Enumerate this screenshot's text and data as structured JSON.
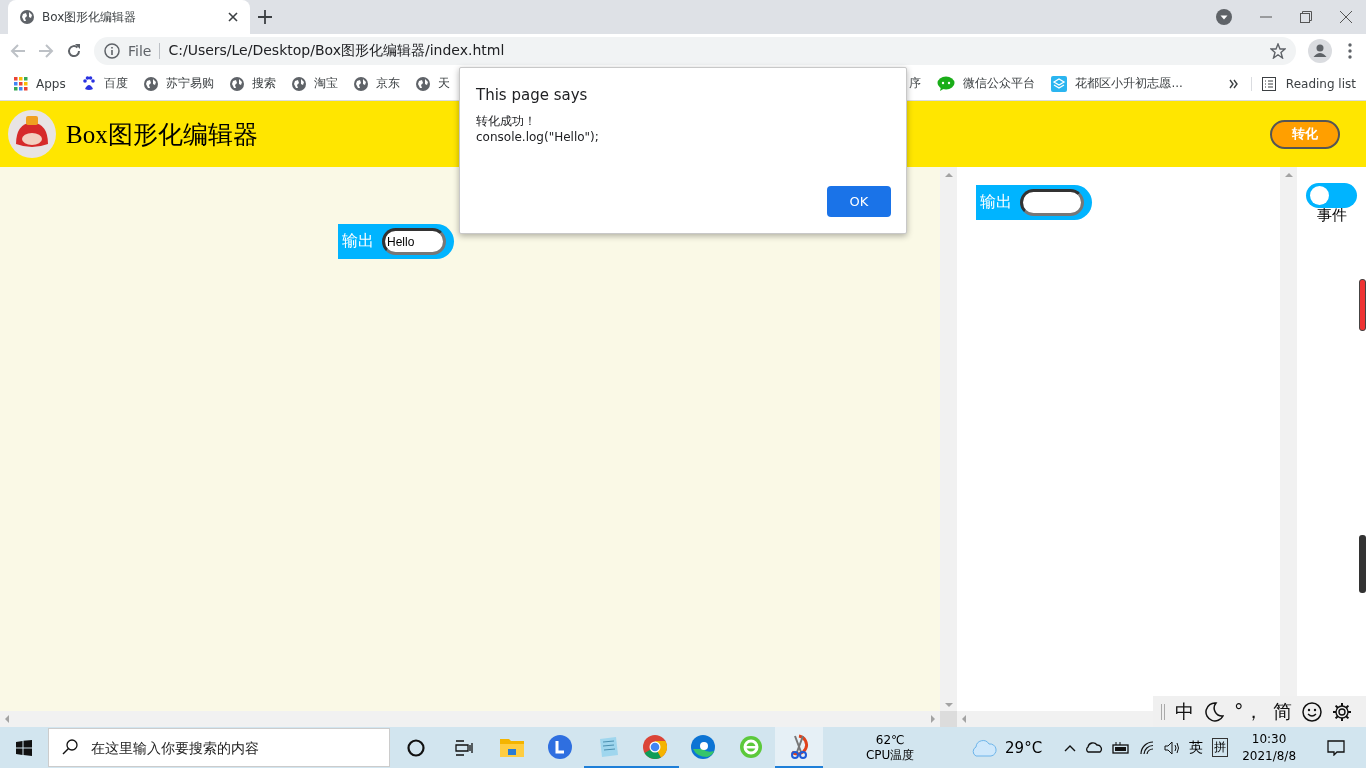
{
  "browser": {
    "tab": {
      "title": "Box图形化编辑器"
    },
    "address": {
      "scheme": "File",
      "url": "C:/Users/Le/Desktop/Box图形化编辑器/index.html"
    },
    "bookmarks": [
      {
        "label": "Apps",
        "kind": "apps"
      },
      {
        "label": "百度",
        "kind": "paw"
      },
      {
        "label": "苏宁易购",
        "kind": "globe"
      },
      {
        "label": "搜索",
        "kind": "globe"
      },
      {
        "label": "淘宝",
        "kind": "globe"
      },
      {
        "label": "京东",
        "kind": "globe"
      },
      {
        "label": "天",
        "kind": "globe"
      }
    ],
    "bookmarks_right": [
      {
        "label": "序",
        "kind": "none"
      },
      {
        "label": "微信公众平台",
        "kind": "chat"
      },
      {
        "label": "花都区小升初志愿...",
        "kind": "stack"
      }
    ],
    "reading_list": "Reading list"
  },
  "app": {
    "title": "Box图形化编辑器",
    "convert_button": "转化",
    "canvas_blocks": [
      {
        "label": "输出",
        "value": "Hello"
      }
    ],
    "panel_blocks": [
      {
        "label": "输出"
      }
    ],
    "event_toggle": {
      "label": "事件",
      "on": false
    }
  },
  "dialog": {
    "title": "This page says",
    "lines": [
      "转化成功！",
      "console.log(\"Hello\");"
    ],
    "ok": "OK"
  },
  "ime_bar": {
    "mode": "中",
    "punctuation": "°，",
    "script": "简"
  },
  "taskbar": {
    "search_placeholder": "在这里输入你要搜索的内容",
    "apps": [
      {
        "kind": "folder",
        "running": false,
        "active": false
      },
      {
        "kind": "letter",
        "running": false,
        "active": false
      },
      {
        "kind": "notepad",
        "running": true,
        "active": false
      },
      {
        "kind": "chrome",
        "running": true,
        "active": false
      },
      {
        "kind": "edge",
        "running": false,
        "active": false
      },
      {
        "kind": "ie",
        "running": false,
        "active": false
      },
      {
        "kind": "scissors",
        "running": true,
        "active": true
      }
    ],
    "cpu": {
      "temp": "62℃",
      "label": "CPU温度"
    },
    "weather": "29°C",
    "lang": "英",
    "ime": "拼",
    "time": "10:30",
    "date": "2021/8/8"
  }
}
